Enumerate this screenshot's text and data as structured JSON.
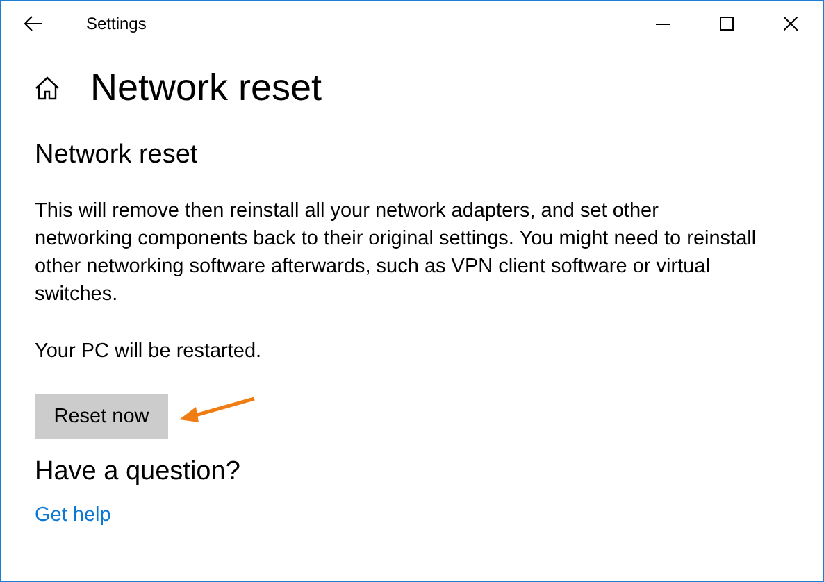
{
  "window": {
    "title": "Settings"
  },
  "page_title": "Network reset",
  "section": {
    "heading": "Network reset",
    "description": "This will remove then reinstall all your network adapters, and set other networking components back to their original settings. You might need to reinstall other networking software afterwards, such as VPN client software or virtual switches.",
    "note": "Your PC will be restarted.",
    "button": "Reset now"
  },
  "help": {
    "heading": "Have a question?",
    "link": "Get help"
  }
}
